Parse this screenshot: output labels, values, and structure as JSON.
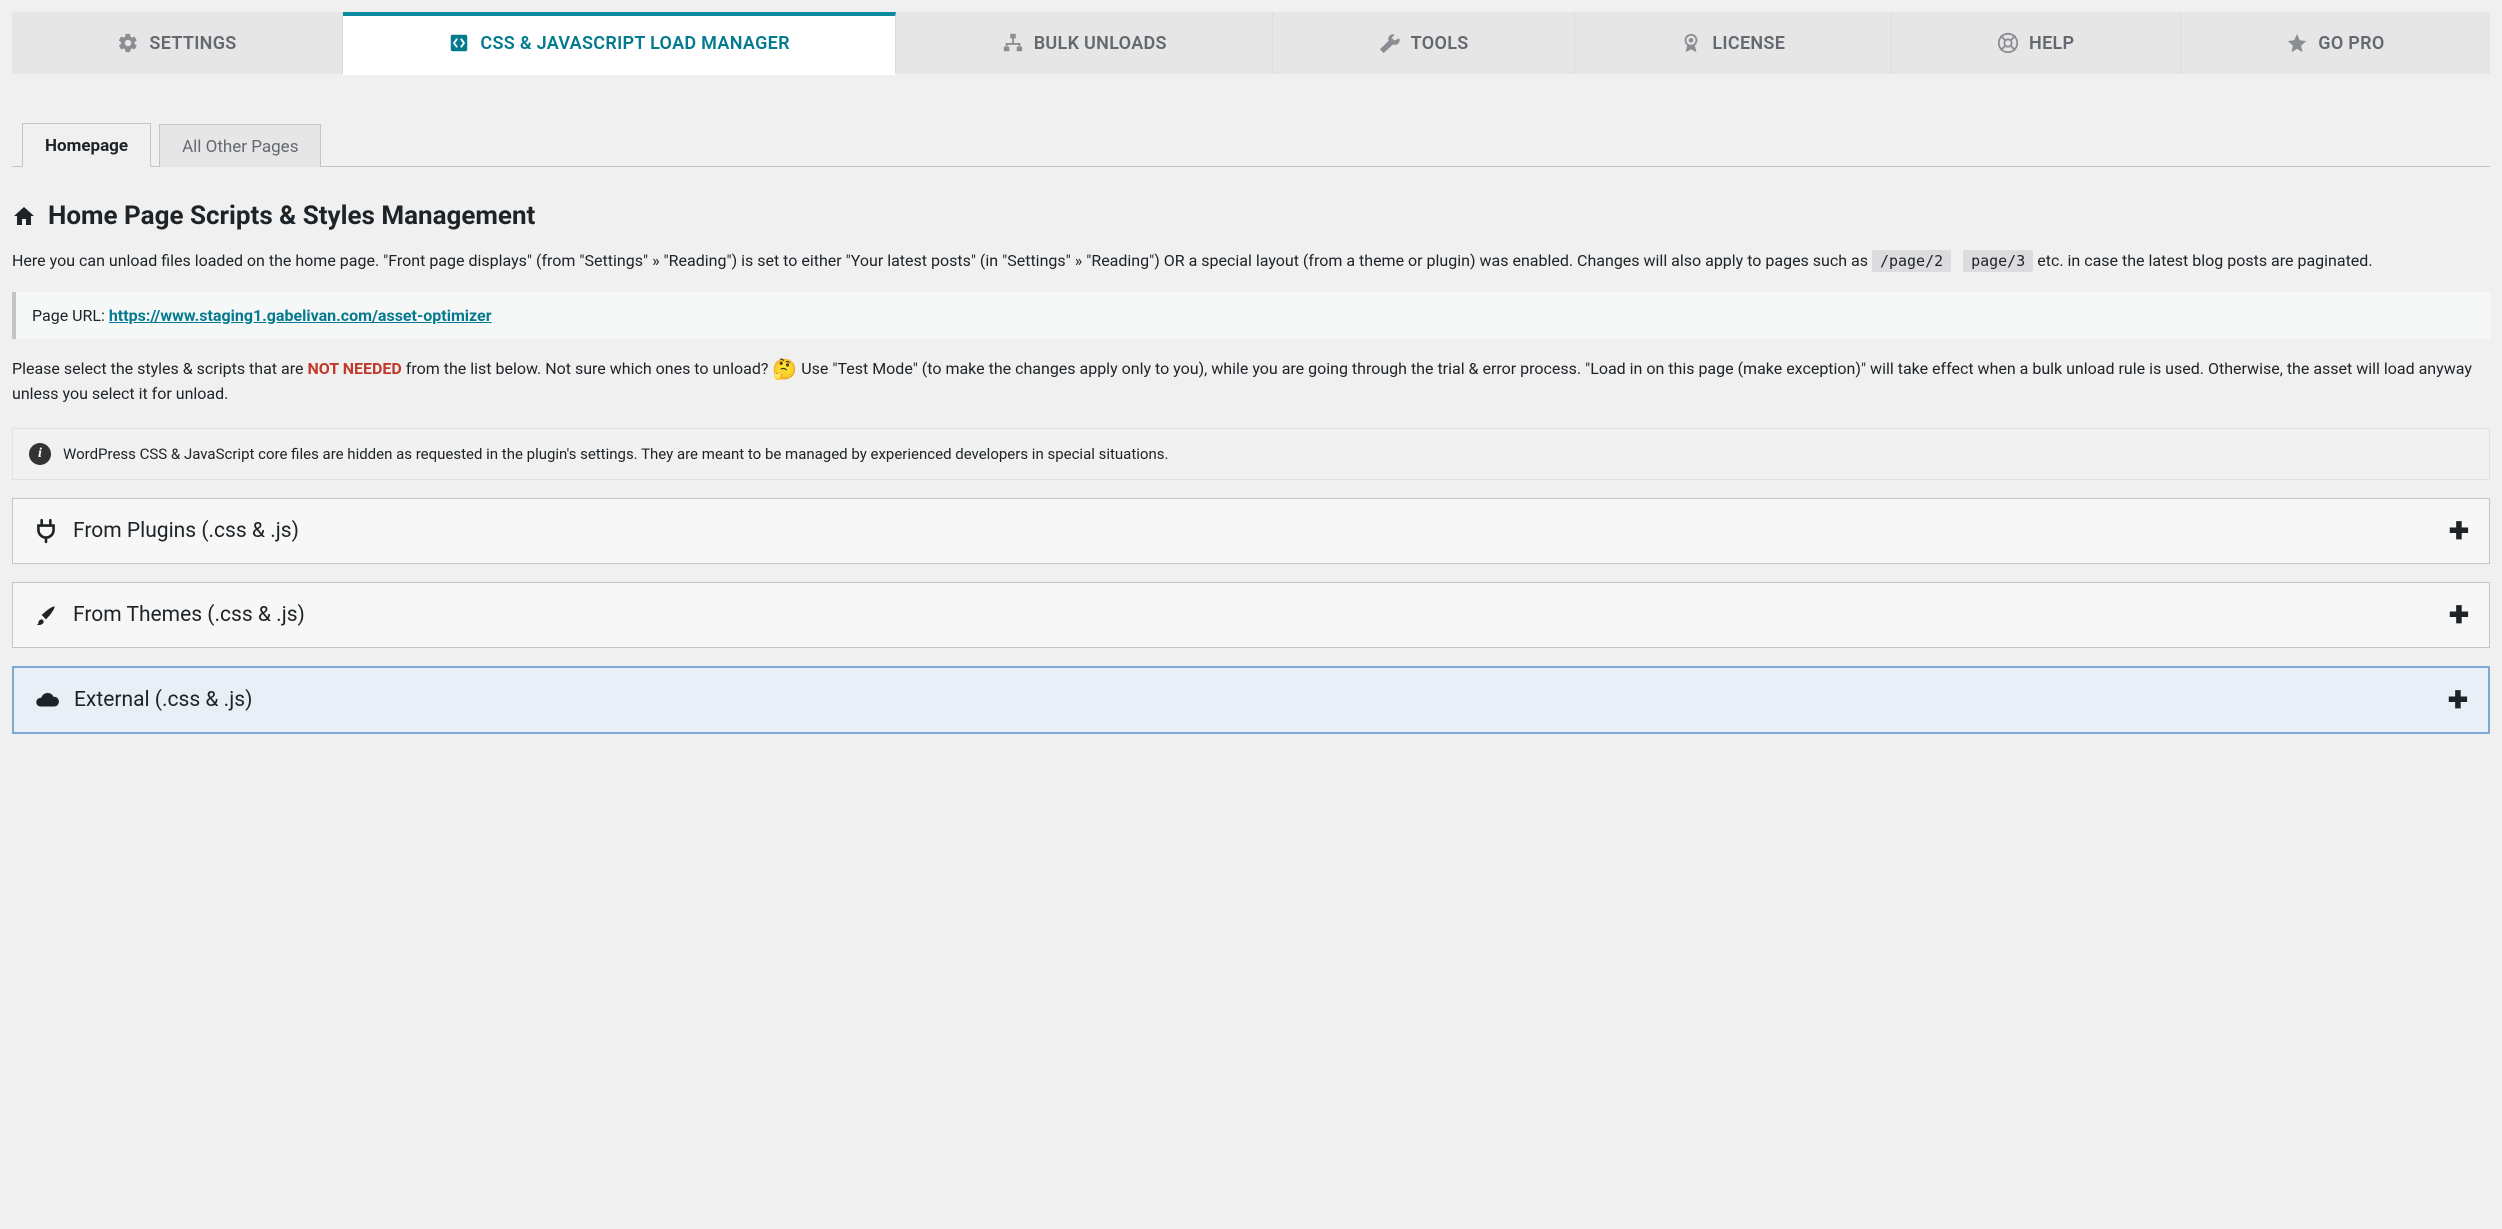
{
  "top_tabs": [
    {
      "label": "SETTINGS",
      "icon": "gear-icon"
    },
    {
      "label": "CSS & JAVASCRIPT LOAD MANAGER",
      "icon": "code-icon"
    },
    {
      "label": "BULK UNLOADS",
      "icon": "sitemap-icon"
    },
    {
      "label": "TOOLS",
      "icon": "wrench-icon"
    },
    {
      "label": "LICENSE",
      "icon": "badge-icon"
    },
    {
      "label": "HELP",
      "icon": "lifesaver-icon"
    },
    {
      "label": "GO PRO",
      "icon": "star-icon"
    }
  ],
  "sub_tabs": {
    "homepage": "Homepage",
    "all_other": "All Other Pages"
  },
  "heading": "Home Page Scripts & Styles Management",
  "desc1_a": "Here you can unload files loaded on the home page. \"Front page displays\" (from \"Settings\" » \"Reading\") is set to either \"Your latest posts\" (in \"Settings\" » \"Reading\") OR a special layout (from a theme or plugin) was enabled. Changes will also apply to pages such as ",
  "code1": "/page/2",
  "code2": "page/3",
  "desc1_b": " etc. in case the latest blog posts are paginated.",
  "page_url_label": "Page URL: ",
  "page_url": "https://www.staging1.gabelivan.com/asset-optimizer",
  "desc2_a": "Please select the styles & scripts that are ",
  "not_needed": "NOT NEEDED",
  "desc2_b": " from the list below. Not sure which ones to unload? ",
  "emoji": "🤔",
  "desc2_c": " Use \"Test Mode\" (to make the changes apply only to you), while you are going through the trial & error process. \"Load in on this page (make exception)\" will take effect when a bulk unload rule is used. Otherwise, the asset will load anyway unless you select it for unload.",
  "info_text": "WordPress CSS & JavaScript core files are hidden as requested in the plugin's settings. They are meant to be managed by experienced developers in special situations.",
  "accordions": [
    {
      "label": "From Plugins (.css & .js)",
      "icon": "plug-icon"
    },
    {
      "label": "From Themes (.css & .js)",
      "icon": "brush-icon"
    },
    {
      "label": "External (.css & .js)",
      "icon": "cloud-icon"
    }
  ]
}
